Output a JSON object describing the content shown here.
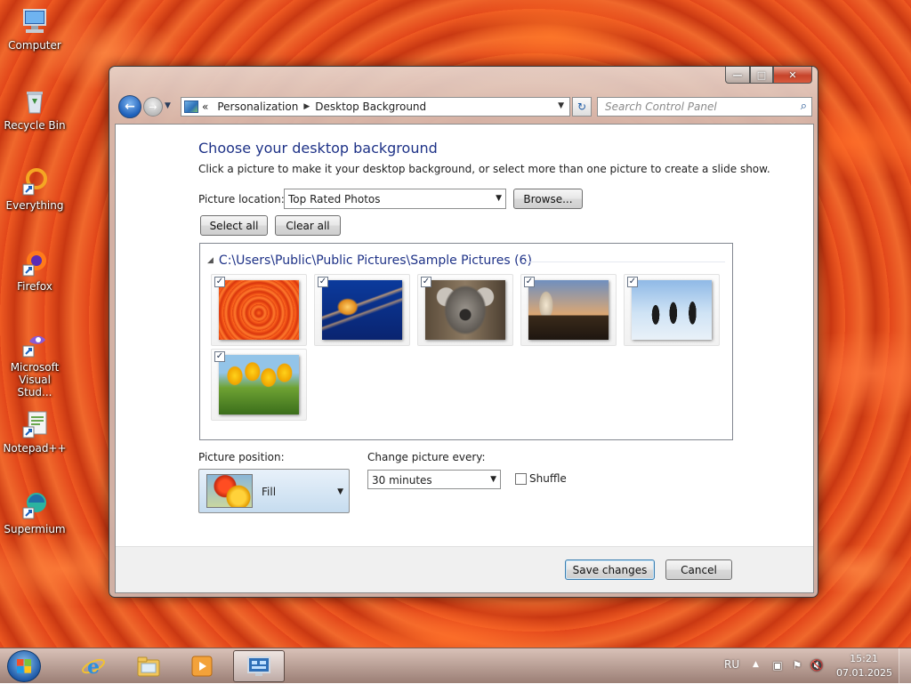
{
  "desktop": {
    "icons": [
      {
        "label": "Computer",
        "icon": "computer-icon"
      },
      {
        "label": "Recycle Bin",
        "icon": "recycle-bin-icon"
      },
      {
        "label": "Everything",
        "icon": "everything-icon"
      },
      {
        "label": "Firefox",
        "icon": "firefox-icon"
      },
      {
        "label": "Microsoft Visual Stud...",
        "icon": "visual-studio-icon"
      },
      {
        "label": "Notepad++",
        "icon": "notepad-plus-plus-icon"
      },
      {
        "label": "Supermium",
        "icon": "supermium-icon"
      }
    ]
  },
  "window": {
    "caption_buttons": {
      "minimize": "—",
      "maximize": "□",
      "close": "✕"
    },
    "nav": {
      "back": "←",
      "forward": "→",
      "address_root": "«",
      "breadcrumb": [
        "Personalization",
        "Desktop Background"
      ],
      "breadcrumb_separator": "▶",
      "refresh": "↻",
      "search_placeholder": "Search Control Panel",
      "search_icon": "⌕"
    },
    "content": {
      "title": "Choose your desktop background",
      "description": "Click a picture to make it your desktop background, or select more than one picture to create a slide show.",
      "picture_location_label": "Picture location:",
      "picture_location_value": "Top Rated Photos",
      "browse_label": "Browse...",
      "select_all_label": "Select all",
      "clear_all_label": "Clear all",
      "group_header": "C:\\Users\\Public\\Public Pictures\\Sample Pictures (6)",
      "pictures": [
        {
          "name": "Chrysanthemum",
          "checked": true
        },
        {
          "name": "Jellyfish",
          "checked": true
        },
        {
          "name": "Koala",
          "checked": true
        },
        {
          "name": "Lighthouse",
          "checked": true
        },
        {
          "name": "Penguins",
          "checked": true
        },
        {
          "name": "Tulips",
          "checked": true
        }
      ],
      "picture_position_label": "Picture position:",
      "picture_position_value": "Fill",
      "change_every_label": "Change picture every:",
      "change_every_value": "30 minutes",
      "shuffle_label": "Shuffle",
      "shuffle_checked": false,
      "save_label": "Save changes",
      "cancel_label": "Cancel"
    }
  },
  "taskbar": {
    "pinned": [
      "internet-explorer-icon",
      "windows-explorer-icon",
      "media-player-icon",
      "control-panel-icon"
    ],
    "active_index": 3,
    "language": "RU",
    "time": "15:21",
    "date": "07.01.2025"
  },
  "colors": {
    "title_blue": "#1e3287",
    "wallpaper_orange": "#df4a1c",
    "button_border_default": "#3c7fb1"
  }
}
